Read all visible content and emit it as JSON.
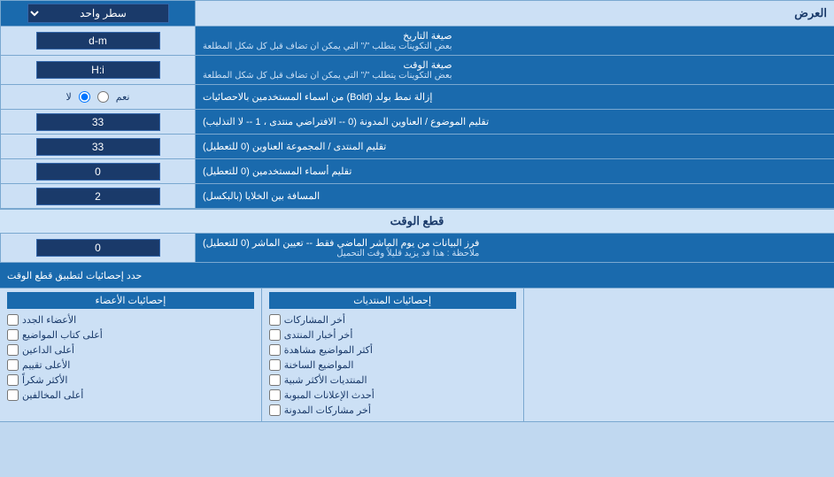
{
  "title": "العرض",
  "rows": [
    {
      "id": "single-line",
      "label": "",
      "input_type": "dropdown",
      "input_value": "سطر واحد",
      "label_text": "العرض"
    },
    {
      "id": "date-format",
      "label": "صيغة التاريخ\nبعض التكوينات يتطلب \"/\" التي يمكن ان تضاف قبل كل شكل المطلعة",
      "label_line1": "صيغة التاريخ",
      "label_line2": "بعض التكوينات يتطلب \"/\" التي يمكن ان تضاف قبل كل شكل المطلعة",
      "input_type": "text",
      "input_value": "d-m"
    },
    {
      "id": "time-format",
      "label_line1": "صيغة الوقت",
      "label_line2": "بعض التكوينات يتطلب \"/\" التي يمكن ان تضاف قبل كل شكل المطلعة",
      "input_type": "text",
      "input_value": "H:i"
    },
    {
      "id": "bold-remove",
      "label": "إزالة نمط بولد (Bold) من اسماء المستخدمين بالاحصائيات",
      "input_type": "radio",
      "radio_yes": "نعم",
      "radio_no": "لا",
      "radio_selected": "no"
    },
    {
      "id": "subject-titles",
      "label": "تقليم الموضوع / العناوين المدونة (0 -- الافتراضي منتدى ، 1 -- لا التذليب)",
      "input_type": "text",
      "input_value": "33"
    },
    {
      "id": "forum-titles",
      "label": "تقليم المنتدى / المجموعة العناوين (0 للتعطيل)",
      "input_type": "text",
      "input_value": "33"
    },
    {
      "id": "usernames-trim",
      "label": "تقليم أسماء المستخدمين (0 للتعطيل)",
      "input_type": "text",
      "input_value": "0"
    },
    {
      "id": "cell-spacing",
      "label": "المسافة بين الخلايا (بالبكسل)",
      "input_type": "text",
      "input_value": "2"
    }
  ],
  "section_cutoff": "قطع الوقت",
  "cutoff_row": {
    "label_line1": "فرز البيانات من يوم الماشر الماضي فقط -- تعيين الماشر (0 للتعطيل)",
    "label_line2": "ملاحظة : هذا قد يزيد قليلاً وقت التحميل",
    "input_value": "0"
  },
  "limit_label": "حدد إحصائيات لتطبيق قطع الوقت",
  "checkboxes": {
    "col1_header": "إحصائيات الأعضاء",
    "col1_items": [
      "الأعضاء الجدد",
      "أعلى كتاب المواضيع",
      "أعلى الداعين",
      "الأعلى تقييم",
      "الأكثر شكراً",
      "أعلى المخالفين"
    ],
    "col2_header": "إحصائيات المنتديات",
    "col2_items": [
      "أخر المشاركات",
      "أخر أخبار المنتدى",
      "أكثر المواضيع مشاهدة",
      "المواضيع الساخنة",
      "المنتديات الأكثر شبية",
      "أحدث الإعلانات المبوبة",
      "أخر مشاركات المدونة"
    ],
    "col3_header": "",
    "col3_items": []
  }
}
